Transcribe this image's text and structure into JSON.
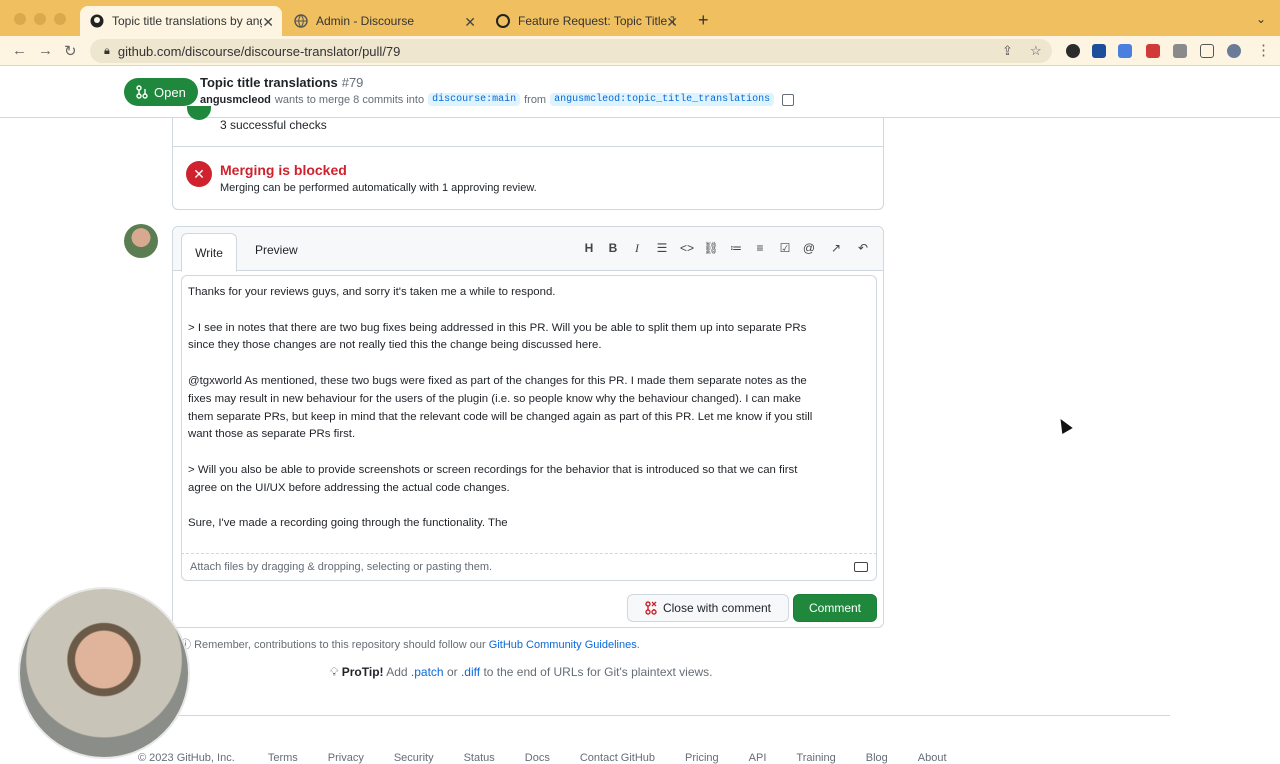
{
  "browser": {
    "tabs": [
      {
        "label": "Topic title translations by angu",
        "active": true
      },
      {
        "label": "Admin - Discourse",
        "active": false
      },
      {
        "label": "Feature Request: Topic Title Tr",
        "active": false
      }
    ],
    "url": "github.com/discourse/discourse-translator/pull/79"
  },
  "pr": {
    "state": "Open",
    "title": "Topic title translations",
    "number": "#79",
    "author": "angusmcleod",
    "meta_text": "wants to merge 8 commits into",
    "base_branch": "discourse:main",
    "from_text": "from",
    "head_branch": "angusmcleod:topic_title_translations"
  },
  "merge": {
    "checks_text": "3 successful checks",
    "blocked_title": "Merging is blocked",
    "blocked_sub": "Merging can be performed automatically with 1 approving review."
  },
  "comment": {
    "tab_write": "Write",
    "tab_preview": "Preview",
    "toolbar": [
      "H",
      "B",
      "I",
      "quote",
      "code",
      "link",
      "ul",
      "ol",
      "tasklist",
      "mention",
      "reference",
      "undo"
    ],
    "body_lines": [
      "Thanks for your reviews guys, and sorry it's taken me a while to respond.",
      "",
      "> I see in notes that there are two bug fixes being addressed in this PR. Will you be able to split them up into separate PRs",
      "since they those changes are not really tied this the change being discussed here.",
      "",
      "@tgxworld As mentioned, these two bugs were fixed as part of the changes for this PR. I made them separate notes as the",
      "fixes may result in new behaviour for the users of the plugin (i.e. so people know why the behaviour changed). I can make",
      "them separate PRs, but keep in mind that the relevant code will be changed again as part of this PR. Let me know if you still",
      "want those as separate PRs first.",
      "",
      "> Will you also be able to provide screenshots or screen recordings for the behavior that is introduced so that we can first",
      "agree on the UI/UX before addressing the actual code changes.",
      "",
      "Sure, I've made a recording going through the functionality. The"
    ],
    "attach_text": "Attach files by dragging & dropping, selecting or pasting them.",
    "close_label": "Close with comment",
    "comment_label": "Comment"
  },
  "remember": {
    "text": "Remember, contributions to this repository should follow our",
    "link": "GitHub Community Guidelines",
    "end": "."
  },
  "protip": {
    "label": "ProTip!",
    "pre": "Add",
    "patch": ".patch",
    "or": "or",
    "diff": ".diff",
    "post": "to the end of URLs for Git's plaintext views."
  },
  "footer": {
    "copyright": "© 2023 GitHub, Inc.",
    "links": [
      "Terms",
      "Privacy",
      "Security",
      "Status",
      "Docs",
      "Contact GitHub",
      "Pricing",
      "API",
      "Training",
      "Blog",
      "About"
    ]
  },
  "colors": {
    "accent_green": "#1f883d",
    "danger_red": "#cf222e",
    "link_blue": "#0969da",
    "chrome_yellow": "#f0c060"
  }
}
